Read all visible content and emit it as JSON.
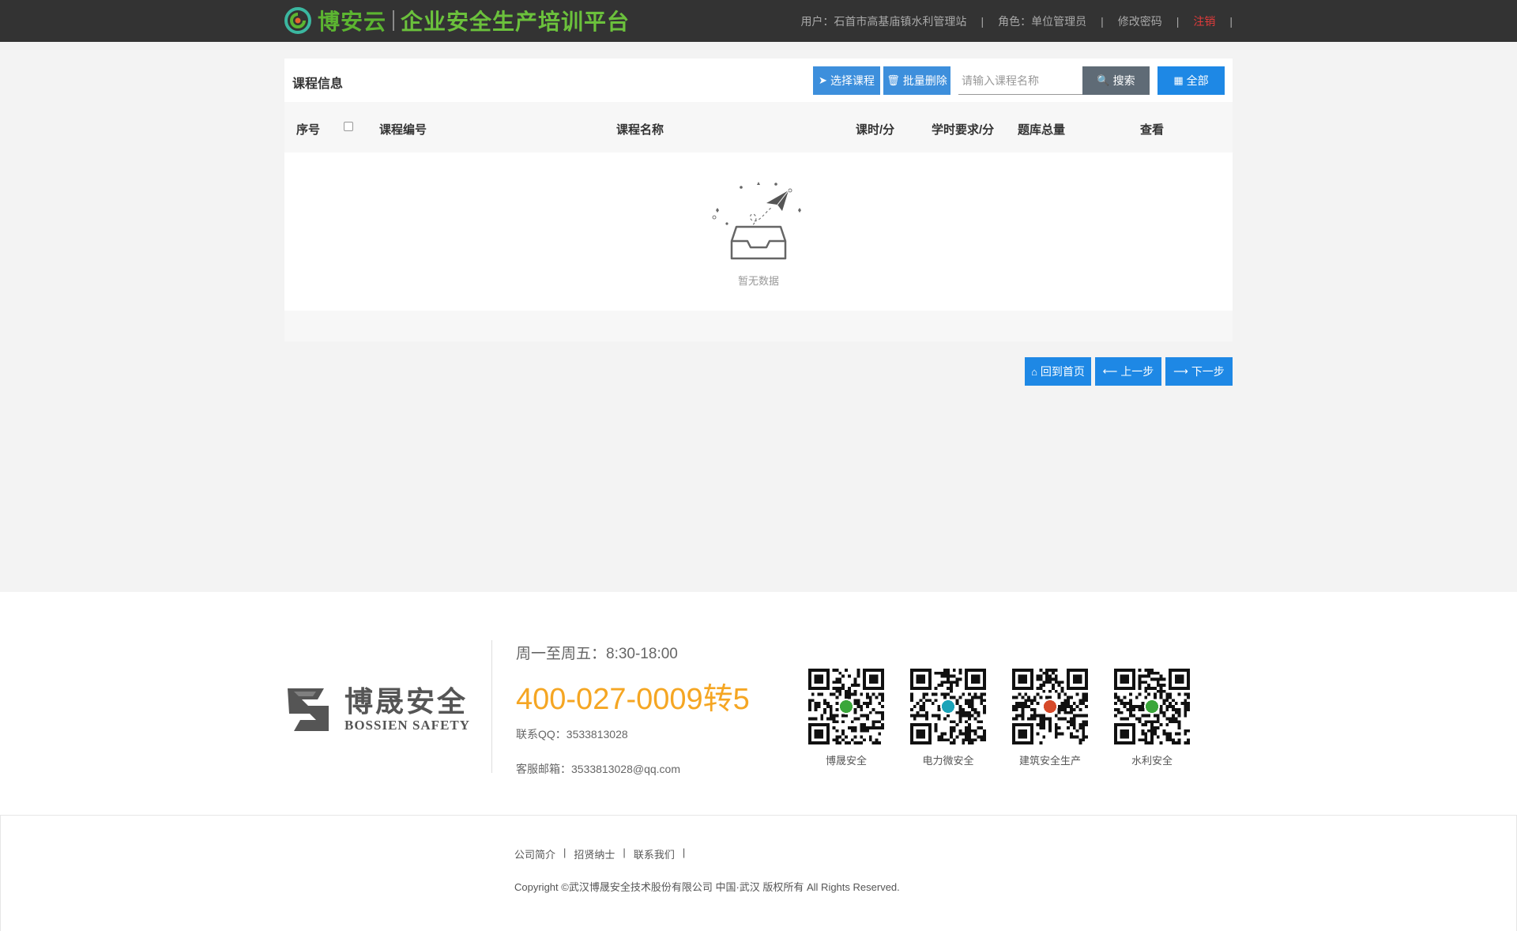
{
  "header": {
    "brand": "博安云",
    "platform_title": "企业安全生产培训平台",
    "user_label": "用户：石首市高基庙镇水利管理站",
    "role_label": "角色：单位管理员",
    "change_password": "修改密码",
    "logout": "注销",
    "separator": "|"
  },
  "panel": {
    "title": "课程信息",
    "select_course_btn": "选择课程",
    "batch_delete_btn": "批量删除",
    "search_placeholder": "请输入课程名称",
    "search_btn": "搜索",
    "all_btn": "全部",
    "columns": [
      "序号",
      "课程编号",
      "课程名称",
      "课时/分",
      "学时要求/分",
      "题库总量",
      "查看"
    ],
    "empty_text": "暂无数据"
  },
  "nav": {
    "home_btn": "回到首页",
    "prev_btn": "上一步",
    "next_btn": "下一步"
  },
  "footer": {
    "logo_cn": "博晟安全",
    "logo_en": "BOSSIEN SAFETY",
    "hours": "周一至周五：8:30-18:00",
    "phone": "400-027-0009转5",
    "qq": "联系QQ：3533813028",
    "email": "客服邮箱：3533813028@qq.com",
    "qr_codes": [
      {
        "label": "博晟安全",
        "badge_color": "#3aa63a"
      },
      {
        "label": "电力微安全",
        "badge_color": "#1aa3b8"
      },
      {
        "label": "建筑安全生产",
        "badge_color": "#d64a2a"
      },
      {
        "label": "水利安全",
        "badge_color": "#3aa63a"
      }
    ],
    "links": [
      "公司简介",
      "招贤纳士",
      "联系我们"
    ],
    "copyright": "Copyright ©武汉博晟安全技术股份有限公司 中国·武汉 版权所有 All Rights Reserved."
  },
  "colors": {
    "topbar": "#333333",
    "brand_green": "#6bc13c",
    "button_blue": "#1e88e5",
    "logout_red": "#e23b3b",
    "phone_orange": "#f5a623"
  }
}
